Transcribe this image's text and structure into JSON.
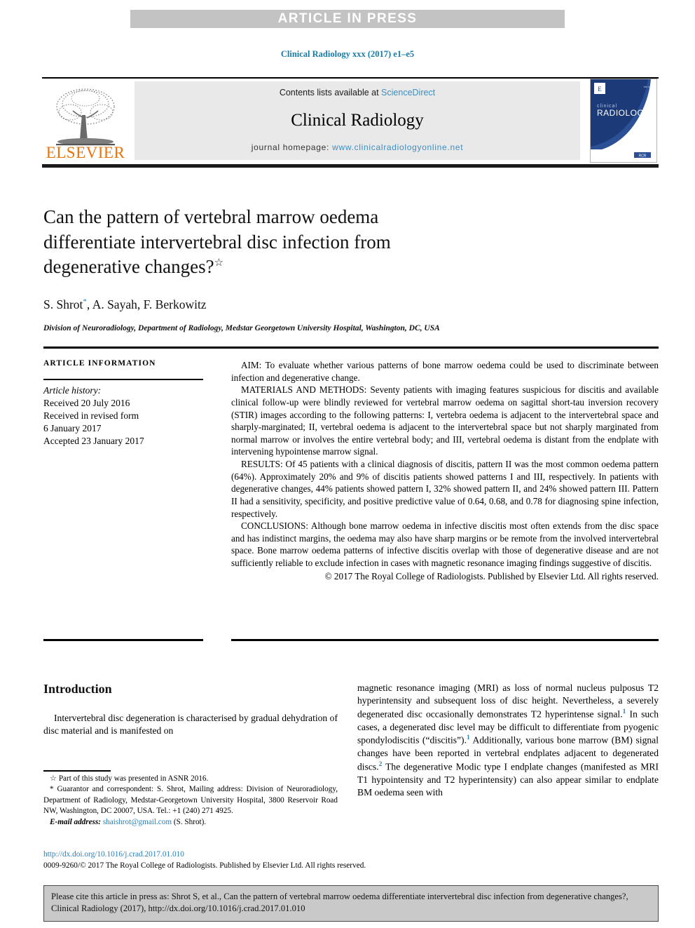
{
  "banner": {
    "text": "ARTICLE IN PRESS"
  },
  "journal_line": {
    "text": "Clinical Radiology xxx (2017) e1–e5"
  },
  "masthead": {
    "contents_prefix": "Contents lists available at ",
    "contents_link": "ScienceDirect",
    "journal_title": "Clinical Radiology",
    "homepage_prefix": "journal homepage: ",
    "homepage_url": "www.clinicalradiologyonline.net",
    "publisher_logo_text": "ELSEVIER",
    "cover_title_small": "clinical",
    "cover_title_large": "RADIOLOGY",
    "colors": {
      "link": "#3d8fc0",
      "logo_orange": "#E8730A",
      "cover_navy": "#16306b",
      "banner_gray": "#c3c3c3",
      "mast_bg": "#e9e9e9"
    }
  },
  "article": {
    "title": "Can the pattern of vertebral marrow oedema differentiate intervertebral disc infection from degenerative changes?",
    "title_marker": "☆",
    "authors": "S. Shrot",
    "author_marker": "*",
    "authors_rest": ", A. Sayah, F. Berkowitz",
    "affiliation": "Division of Neuroradiology, Department of Radiology, Medstar Georgetown University Hospital, Washington, DC, USA"
  },
  "article_information": {
    "heading": "ARTICLE INFORMATION",
    "history_label": "Article history:",
    "received": "Received 20 July 2016",
    "revised_label": "Received in revised form",
    "revised_date": "6 January 2017",
    "accepted": "Accepted 23 January 2017"
  },
  "abstract": {
    "aim": "AIM: To evaluate whether various patterns of bone marrow oedema could be used to discriminate between infection and degenerative change.",
    "methods": "MATERIALS AND METHODS: Seventy patients with imaging features suspicious for discitis and available clinical follow-up were blindly reviewed for vertebral marrow oedema on sagittal short-tau inversion recovery (STIR) images according to the following patterns: I, vertebra oedema is adjacent to the intervertebral space and sharply-marginated; II, vertebral oedema is adjacent to the intervertebral space but not sharply marginated from normal marrow or involves the entire vertebral body; and III, vertebral oedema is distant from the endplate with intervening hypointense marrow signal.",
    "results": "RESULTS: Of 45 patients with a clinical diagnosis of discitis, pattern II was the most common oedema pattern (64%). Approximately 20% and 9% of discitis patients showed patterns I and III, respectively. In patients with degenerative changes, 44% patients showed pattern I, 32% showed pattern II, and 24% showed pattern III. Pattern II had a sensitivity, specificity, and positive predictive value of 0.64, 0.68, and 0.78 for diagnosing spine infection, respectively.",
    "conclusions": "CONCLUSIONS: Although bone marrow oedema in infective discitis most often extends from the disc space and has indistinct margins, the oedema may also have sharp margins or be remote from the involved intervertebral space. Bone marrow oedema patterns of infective discitis overlap with those of degenerative disease and are not sufficiently reliable to exclude infection in cases with magnetic resonance imaging findings suggestive of discitis.",
    "copyright": "© 2017 The Royal College of Radiologists. Published by Elsevier Ltd. All rights reserved."
  },
  "body": {
    "section_heading": "Introduction",
    "left_paragraph": "Intervertebral disc degeneration is characterised by gradual dehydration of disc material and is manifested on",
    "right_part1": "magnetic resonance imaging (MRI) as loss of normal nucleus pulposus T2 hyperintensity and subsequent loss of disc height. Nevertheless, a severely degenerated disc occasionally demonstrates T2 hyperintense signal.",
    "right_ref1": "1",
    "right_part2": " In such cases, a degenerated disc level may be difficult to differentiate from pyogenic spondylodiscitis (“discitis”).",
    "right_ref2": "1",
    "right_part3": " Additionally, various bone marrow (BM) signal changes have been reported in vertebral endplates adjacent to degenerated discs.",
    "right_ref3": "2",
    "right_part4": " The degenerative Modic type I endplate changes (manifested as MRI T1 hypointensity and T2 hyperintensity) can also appear similar to endplate BM oedema seen with"
  },
  "footnotes": {
    "star_marker": "☆",
    "star_text": " Part of this study was presented in ASNR 2016.",
    "corr_marker": "*",
    "corr_text": " Guarantor and correspondent: S. Shrot, Mailing address: Division of Neuroradiology, Department of Radiology, Medstar-Georgetown University Hospital, 3800 Reservoir Road NW, Washington, DC 20007, USA. Tel.: +1 (240) 271 4925.",
    "email_label": "E-mail address:",
    "email": "shaishrot@gmail.com",
    "email_suffix": " (S. Shrot)."
  },
  "doi_block": {
    "doi_url": "http://dx.doi.org/10.1016/j.crad.2017.01.010",
    "copyright_line": "0009-9260/© 2017 The Royal College of Radiologists. Published by Elsevier Ltd. All rights reserved."
  },
  "cite_box": {
    "text": "Please cite this article in press as: Shrot S, et al., Can the pattern of vertebral marrow oedema differentiate intervertebral disc infection from degenerative changes?, Clinical Radiology (2017), http://dx.doi.org/10.1016/j.crad.2017.01.010"
  }
}
